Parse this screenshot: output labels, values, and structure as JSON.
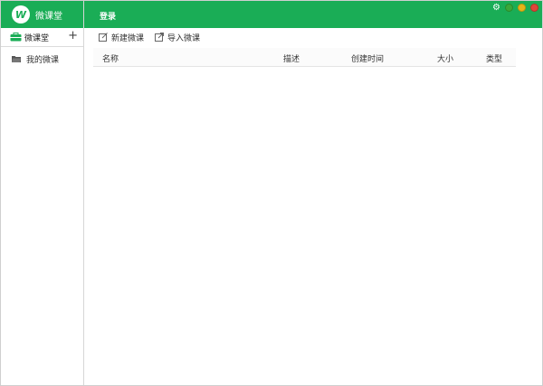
{
  "app": {
    "logo_letter": "W",
    "title": "微课堂"
  },
  "header": {
    "login_label": "登录"
  },
  "window_controls": [
    {
      "name": "settings",
      "icon": "gear-icon"
    },
    {
      "name": "green",
      "icon": "circle-green-icon",
      "color": "#3aa83a"
    },
    {
      "name": "minimize",
      "icon": "minimize-icon",
      "color": "#e6b419"
    },
    {
      "name": "close",
      "icon": "close-icon",
      "color": "#e0453a"
    }
  ],
  "sidebar": {
    "header_label": "微课堂",
    "add_icon": "plus-icon",
    "items": [
      {
        "label": "我的微课",
        "icon": "folder-icon"
      }
    ]
  },
  "toolbar": {
    "new_label": "新建微课",
    "import_label": "导入微课"
  },
  "table": {
    "columns": [
      "名称",
      "描述",
      "创建时间",
      "大小",
      "类型"
    ],
    "rows": []
  },
  "colors": {
    "brand": "#1aad56"
  }
}
